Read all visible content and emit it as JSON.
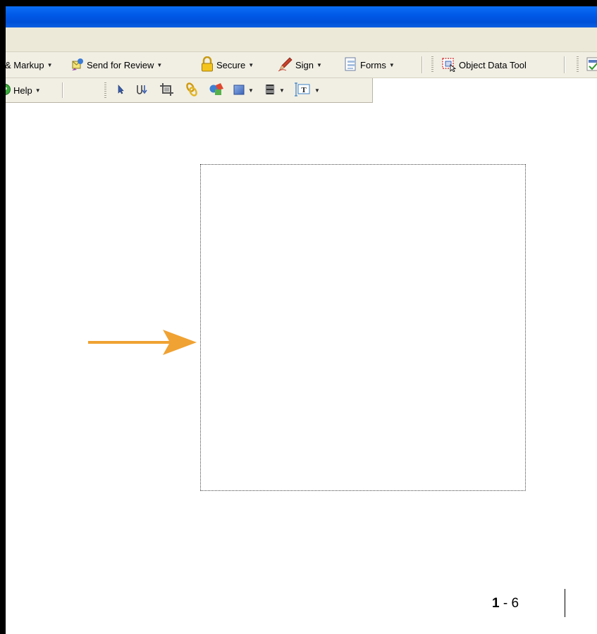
{
  "toolbar_main": {
    "markup_label": "& Markup",
    "send_review_label": "Send for Review",
    "secure_label": "Secure",
    "sign_label": "Sign",
    "forms_label": "Forms",
    "object_data_label": "Object Data Tool"
  },
  "toolbar_secondary": {
    "help_label": "Help"
  },
  "icons": {
    "send_review": "send-review-icon",
    "secure": "padlock-icon",
    "sign": "pen-icon",
    "forms": "forms-icon",
    "object_data": "object-data-icon",
    "spellcheck": "spellcheck-icon",
    "help": "help-icon",
    "select": "arrow-cursor-icon",
    "touchup": "touchup-icon",
    "crop": "crop-icon",
    "link": "link-icon",
    "3d": "3d-object-icon",
    "rectangle": "rectangle-icon",
    "movie": "movie-icon",
    "text_field": "text-field-icon"
  },
  "colors": {
    "title_bar": "#0058e6",
    "toolbar_bg": "#f1efe4",
    "arrow": "#f0a232"
  },
  "page": {
    "chapter": "1",
    "separator": " - ",
    "number": "6"
  }
}
